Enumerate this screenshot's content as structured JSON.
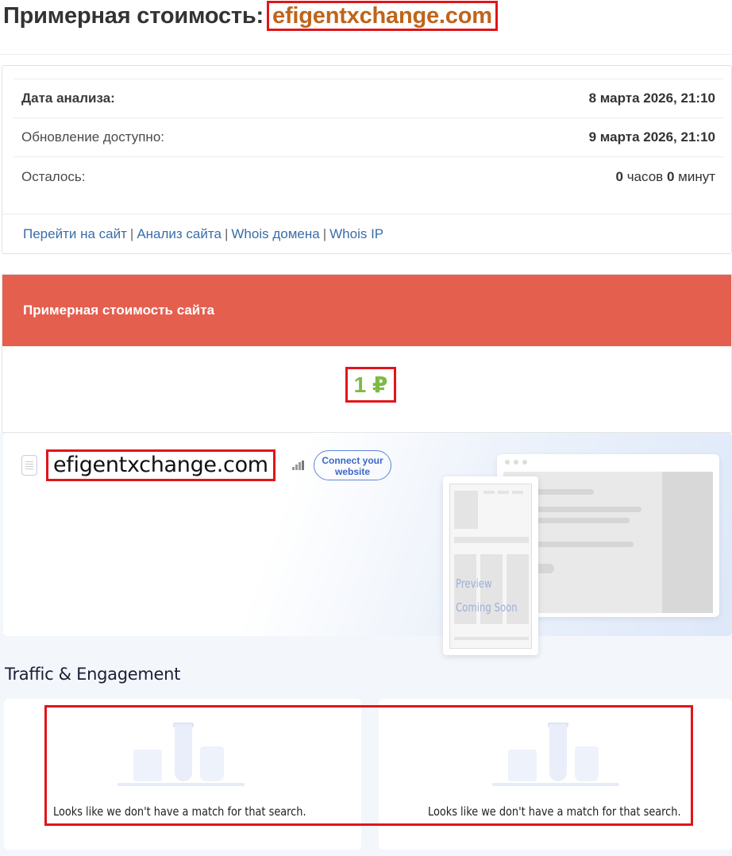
{
  "header": {
    "title_prefix": "Примерная стоимость:",
    "domain": "efigentxchange.com"
  },
  "info": {
    "rows": [
      {
        "label": "Дата анализа:",
        "value": "8 марта 2026, 21:10"
      },
      {
        "label": "Обновление доступно:",
        "value": "9 марта 2026, 21:10"
      }
    ],
    "remaining": {
      "label": "Осталось:",
      "hours": "0",
      "hours_unit": "часов",
      "minutes": "0",
      "minutes_unit": "минут"
    },
    "links": [
      "Перейти на сайт",
      "Анализ сайта",
      "Whois домена",
      "Whois IP"
    ],
    "separator": "|"
  },
  "valuation": {
    "heading": "Примерная стоимость сайта",
    "amount": "1 ₽"
  },
  "similarweb": {
    "domain": "efigentxchange.com",
    "connect_button": "Connect your website",
    "preview_line1": "Preview",
    "preview_line2": "Coming Soon",
    "section_title": "Traffic & Engagement",
    "empty_messages": [
      "Looks like we don't have a match for that search.",
      "Looks like we don't have a match for that search."
    ]
  },
  "colors": {
    "accent_red": "#e55f4f",
    "highlight_border": "#e1151a",
    "domain_orange": "#c0641a",
    "price_green": "#7dbb44",
    "link_blue": "#3a6da8"
  }
}
